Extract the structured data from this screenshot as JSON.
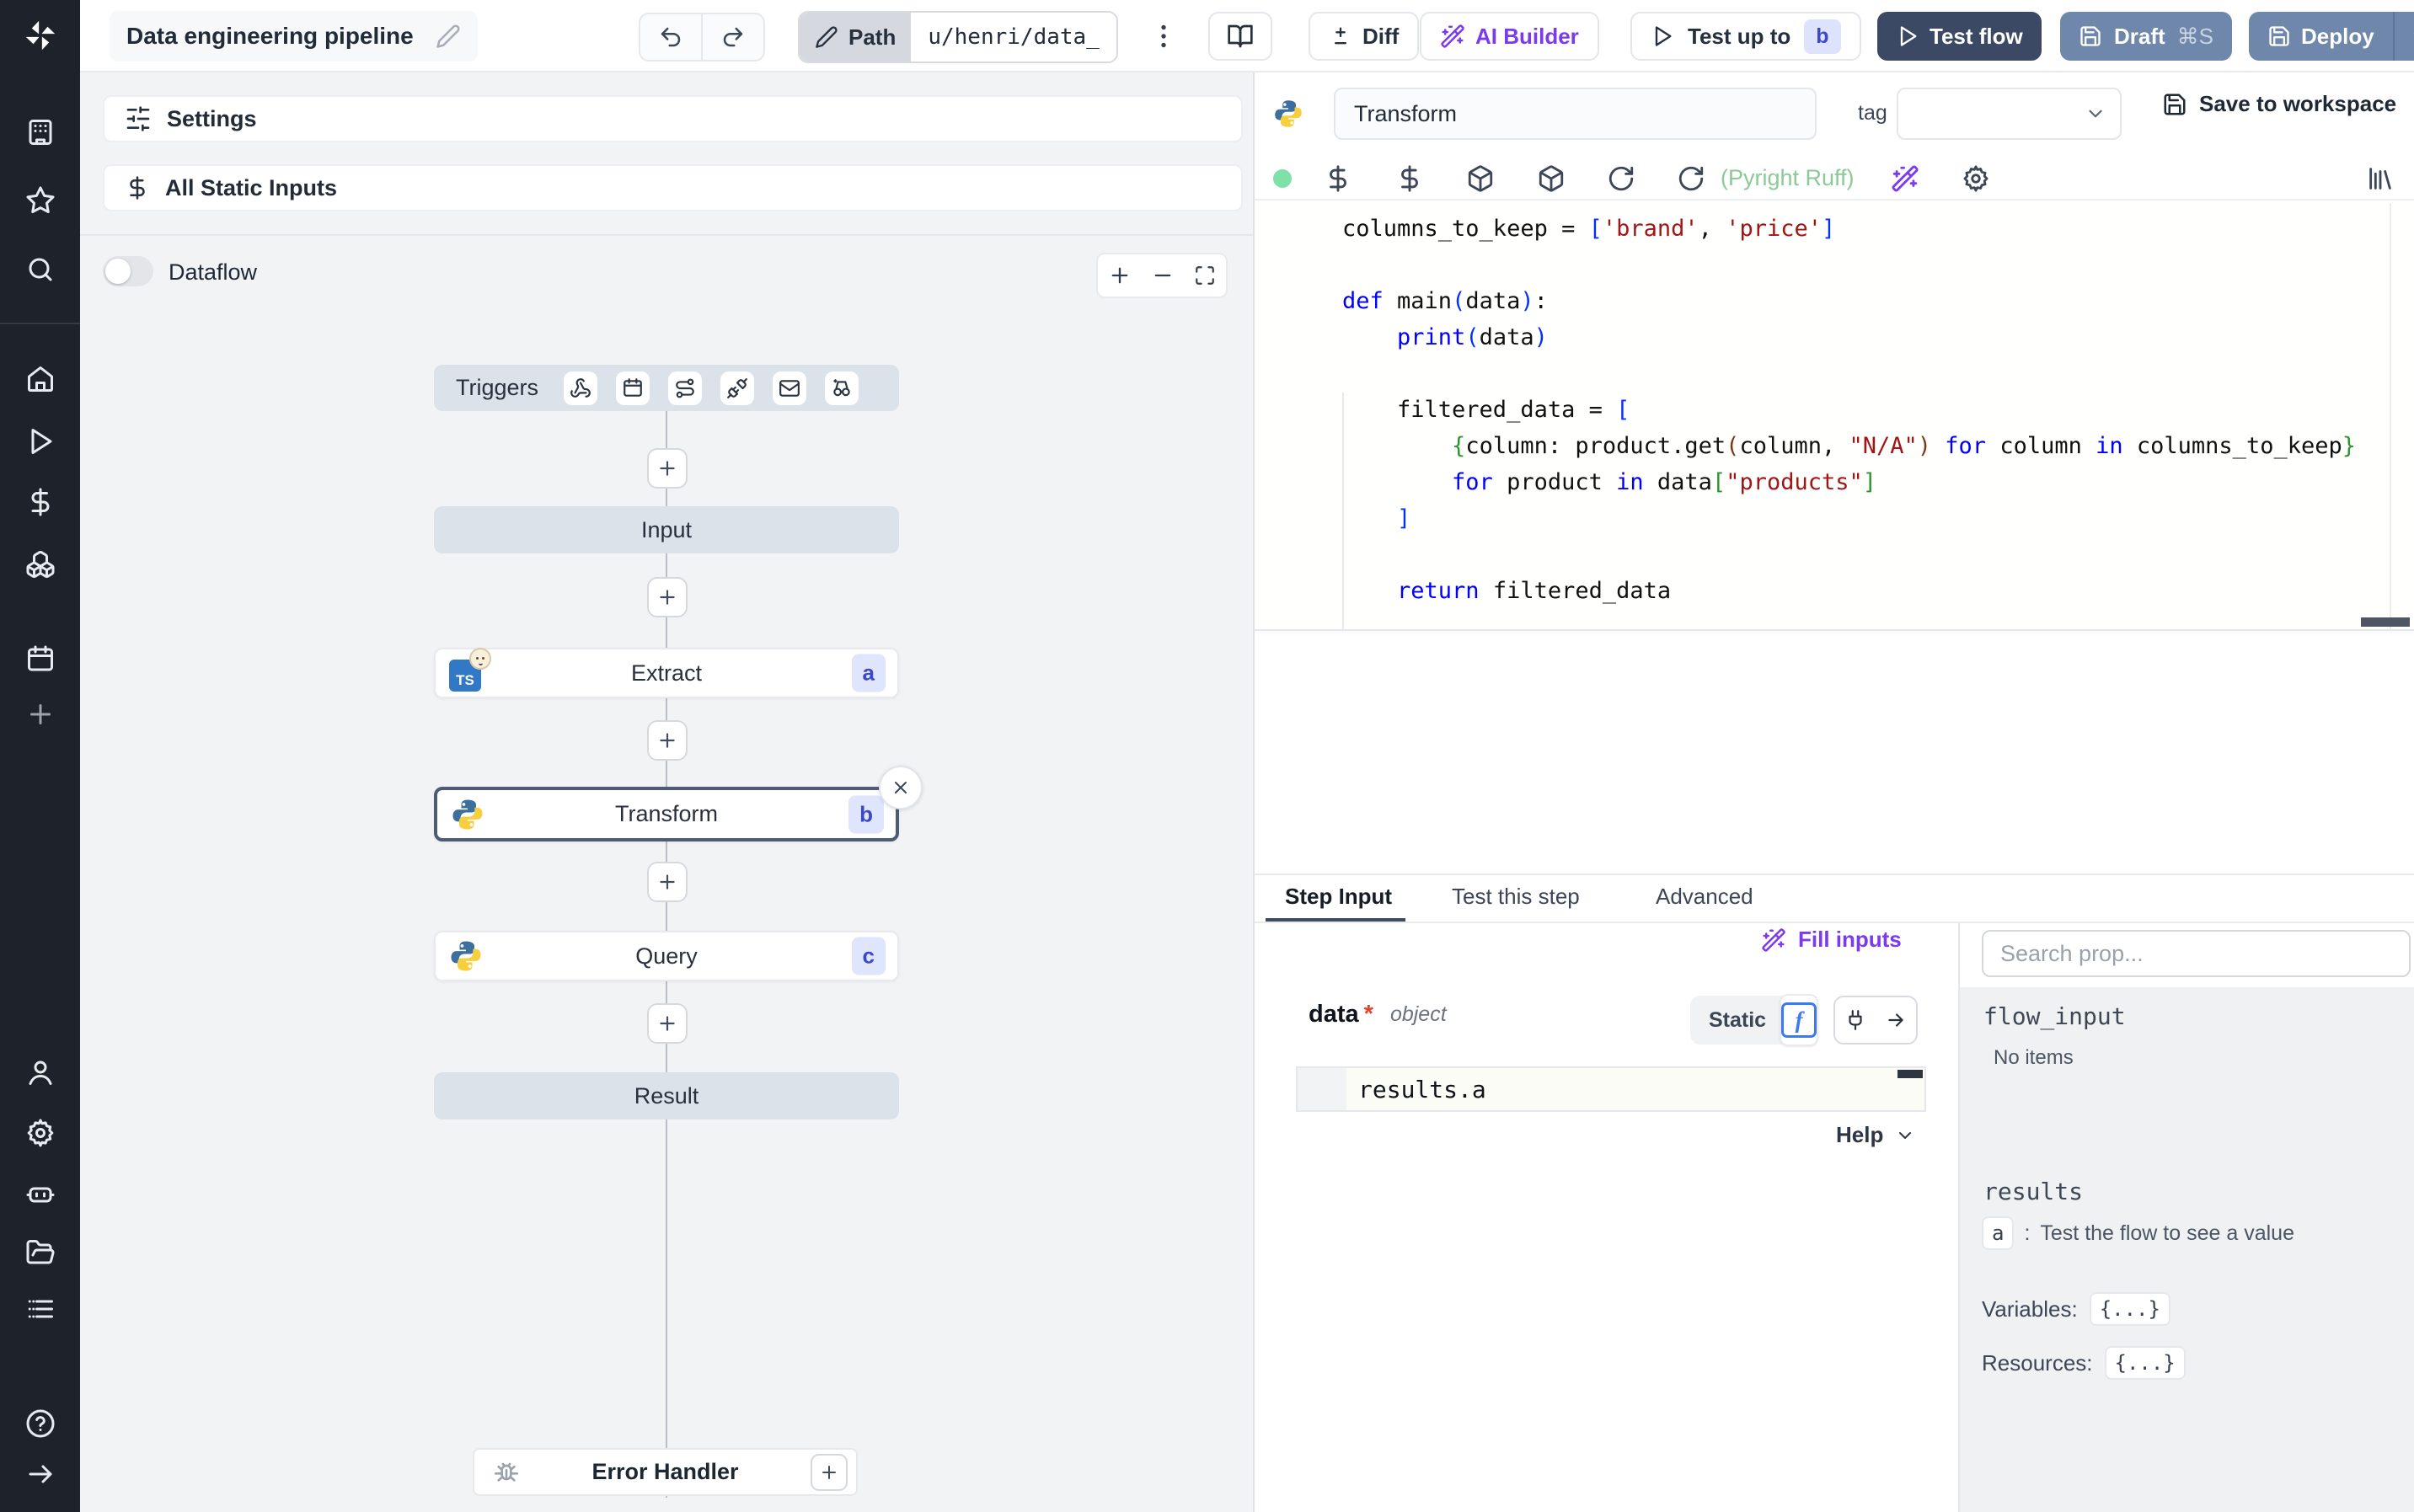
{
  "topbar": {
    "title": "Data engineering pipeline",
    "path_label": "Path",
    "path_value": "u/henri/data_",
    "diff_label": "Diff",
    "ai_builder_label": "AI Builder",
    "test_up_to_label": "Test up to",
    "test_up_to_badge": "b",
    "test_flow_label": "Test flow",
    "draft_label": "Draft",
    "draft_shortcut": "⌘S",
    "deploy_label": "Deploy"
  },
  "flow": {
    "settings_label": "Settings",
    "static_inputs_label": "All Static Inputs",
    "dataflow_label": "Dataflow",
    "triggers_label": "Triggers",
    "nodes": {
      "input": {
        "label": "Input"
      },
      "extract": {
        "label": "Extract",
        "badge": "a",
        "lang": "TS"
      },
      "transform": {
        "label": "Transform",
        "badge": "b"
      },
      "query": {
        "label": "Query",
        "badge": "c"
      },
      "result": {
        "label": "Result"
      }
    },
    "error_handler_label": "Error Handler"
  },
  "editor": {
    "step_name": "Transform",
    "tag_label": "tag",
    "save_label": "Save to workspace",
    "lint_status": "(Pyright Ruff)",
    "code": {
      "lines": [
        [
          [
            "d",
            "columns_to_keep = "
          ],
          [
            "b1",
            "["
          ],
          [
            "s",
            "'brand'"
          ],
          [
            "d",
            ", "
          ],
          [
            "s",
            "'price'"
          ],
          [
            "b1",
            "]"
          ]
        ],
        [],
        [
          [
            "k",
            "def"
          ],
          [
            "d",
            " main"
          ],
          [
            "b1",
            "("
          ],
          [
            "d",
            "data"
          ],
          [
            "b1",
            ")"
          ],
          [
            "d",
            ":"
          ]
        ],
        [
          [
            "d",
            "    "
          ],
          [
            "k",
            "print"
          ],
          [
            "b1",
            "("
          ],
          [
            "d",
            "data"
          ],
          [
            "b1",
            ")"
          ]
        ],
        [],
        [
          [
            "d",
            "    filtered_data = "
          ],
          [
            "b1",
            "["
          ]
        ],
        [
          [
            "d",
            "        "
          ],
          [
            "b2",
            "{"
          ],
          [
            "d",
            "column: product.get"
          ],
          [
            "b3",
            "("
          ],
          [
            "d",
            "column, "
          ],
          [
            "s",
            "\"N/A\""
          ],
          [
            "b3",
            ")"
          ],
          [
            "d",
            " "
          ],
          [
            "k",
            "for"
          ],
          [
            "d",
            " column "
          ],
          [
            "k",
            "in"
          ],
          [
            "d",
            " columns_to_keep"
          ],
          [
            "b2",
            "}"
          ]
        ],
        [
          [
            "d",
            "        "
          ],
          [
            "k",
            "for"
          ],
          [
            "d",
            " product "
          ],
          [
            "k",
            "in"
          ],
          [
            "d",
            " data"
          ],
          [
            "b2",
            "["
          ],
          [
            "s",
            "\"products\""
          ],
          [
            "b2",
            "]"
          ]
        ],
        [
          [
            "d",
            "    "
          ],
          [
            "b1",
            "]"
          ]
        ],
        [],
        [
          [
            "d",
            "    "
          ],
          [
            "k",
            "return"
          ],
          [
            "d",
            " filtered_data"
          ]
        ]
      ]
    }
  },
  "bottom": {
    "tabs": [
      {
        "label": "Step Input"
      },
      {
        "label": "Test this step"
      },
      {
        "label": "Advanced"
      }
    ],
    "fill_inputs_label": "Fill inputs",
    "field": {
      "name": "data",
      "required": "*",
      "type": "object"
    },
    "static_label": "Static",
    "input_value": "results.a",
    "help_label": "Help",
    "props": {
      "search_placeholder": "Search prop...",
      "flow_input_label": "flow_input",
      "no_items": "No items",
      "results_label": "results",
      "result_badge": "a",
      "result_separator": ":",
      "result_hint": "Test the flow to see a value",
      "variables_label": "Variables:",
      "variables_value": "{...}",
      "resources_label": "Resources:",
      "resources_value": "{...}"
    }
  },
  "colors": {
    "accent_purple": "#7c3aed",
    "test_flow_navy": "#3b4965",
    "deploy_slate": "#6e87aa",
    "badge_bg": "#dfe5fd",
    "badge_text": "#3c49c5",
    "selected_node_border": "#4e5b75",
    "status_green": "#7ee2a8"
  }
}
